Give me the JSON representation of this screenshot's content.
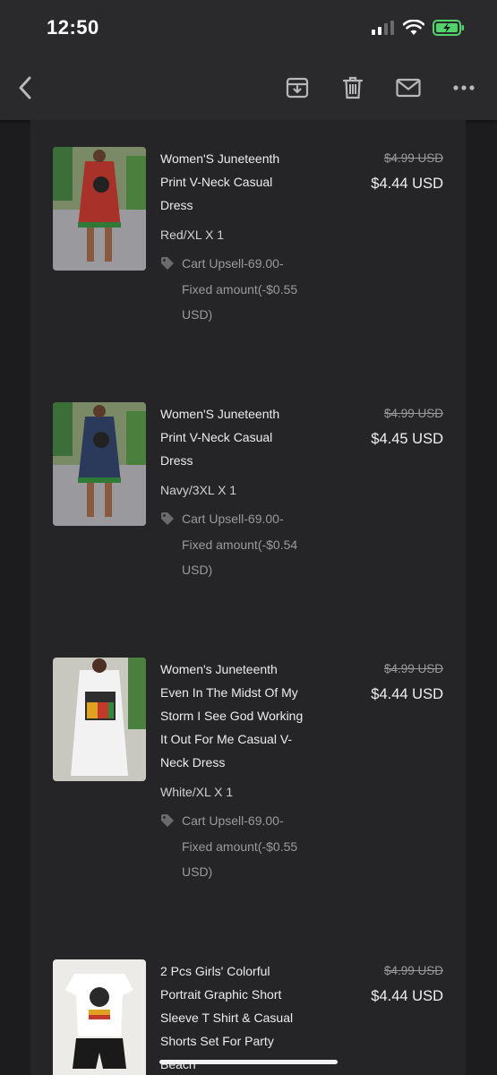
{
  "status": {
    "time": "12:50"
  },
  "colors": {
    "background": "#1c1c1e",
    "toolbar": "#2a2a2c",
    "card": "#252527",
    "text": "#ececec",
    "muted": "#9a9a9a",
    "battery": "#52d26a"
  },
  "toolbar": {
    "icons": [
      "back-arrow-icon",
      "archive-icon",
      "trash-icon",
      "mail-icon",
      "more-icon"
    ]
  },
  "items": [
    {
      "title": "Women'S Juneteenth Print V-Neck Casual Dress",
      "variant": "Red/XL X 1",
      "discount": "Cart Upsell-69.00-Fixed amount(-$0.55 USD)",
      "old_price": "$4.99 USD",
      "new_price": "$4.44 USD",
      "image_color": "#a8322a"
    },
    {
      "title": "Women'S Juneteenth Print V-Neck Casual Dress",
      "variant": "Navy/3XL X 1",
      "discount": "Cart Upsell-69.00-Fixed amount(-$0.54 USD)",
      "old_price": "$4.99 USD",
      "new_price": "$4.45 USD",
      "image_color": "#2b3a5a"
    },
    {
      "title": "Women's Juneteenth Even In The Midst Of My Storm I See God Working It Out For Me Casual V-Neck Dress",
      "variant": "White/XL X 1",
      "discount": "Cart Upsell-69.00-Fixed amount(-$0.55 USD)",
      "old_price": "$4.99 USD",
      "new_price": "$4.44 USD",
      "image_color": "#f2f2f2"
    },
    {
      "title": "2 Pcs Girls' Colorful Portrait Graphic Short Sleeve T Shirt & Casual Shorts Set For Party Beach",
      "old_price": "$4.99 USD",
      "new_price": "$4.44 USD",
      "image_color": "#ffffff"
    }
  ]
}
